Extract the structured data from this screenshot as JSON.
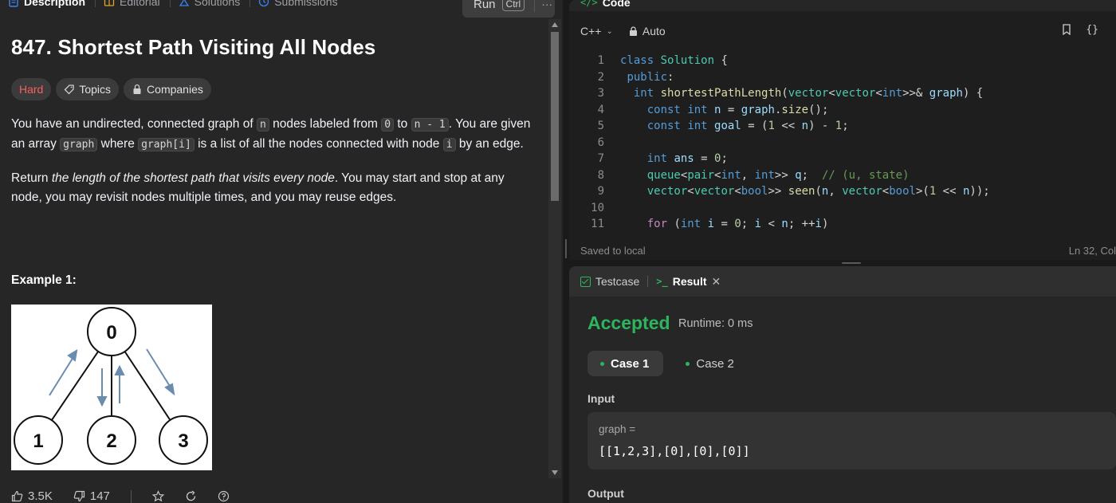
{
  "left_tabs": [
    {
      "label": "Description",
      "icon": "document-icon",
      "active": true
    },
    {
      "label": "Editorial",
      "icon": "book-icon",
      "active": false
    },
    {
      "label": "Solutions",
      "icon": "flask-icon",
      "active": false
    },
    {
      "label": "Submissions",
      "icon": "history-icon",
      "active": false
    }
  ],
  "run_button": {
    "label": "Run",
    "shortcut": "Ctrl"
  },
  "problem": {
    "title": "847. Shortest Path Visiting All Nodes",
    "difficulty": "Hard",
    "tags": [
      "Topics",
      "Companies"
    ],
    "desc1_parts": [
      "You have an undirected, connected graph of ",
      "n",
      " nodes labeled from ",
      "0",
      " to ",
      "n - 1",
      ". You are given an array ",
      "graph",
      " where ",
      "graph[i]",
      " is a list of all the nodes connected with node ",
      "i",
      " by an edge."
    ],
    "desc2_parts": [
      "Return ",
      "the length of the shortest path that visits every node",
      ". You may start and stop at any node, you may revisit nodes multiple times, and you may reuse edges."
    ],
    "example_title": "Example 1:",
    "example_nodes": [
      "0",
      "1",
      "2",
      "3"
    ]
  },
  "footer": {
    "likes": "3.5K",
    "dislikes": "147"
  },
  "code": {
    "header": "Code",
    "language": "C++",
    "mode": "Auto",
    "saved": "Saved to local",
    "cursor": "Ln 32, Col",
    "line_numbers": [
      "1",
      "2",
      "3",
      "4",
      "5",
      "6",
      "7",
      "8",
      "9",
      "10",
      "11"
    ]
  },
  "result": {
    "tabs": [
      "Testcase",
      "Result"
    ],
    "status": "Accepted",
    "runtime": "Runtime: 0 ms",
    "cases": [
      "Case 1",
      "Case 2"
    ],
    "input_label": "Input",
    "input_key": "graph =",
    "input_value": "[[1,2,3],[0],[0],[0]]",
    "output_label": "Output"
  },
  "colors": {
    "accepted": "#2db55d",
    "hard": "#f8615c",
    "accent": "#2db55d"
  }
}
